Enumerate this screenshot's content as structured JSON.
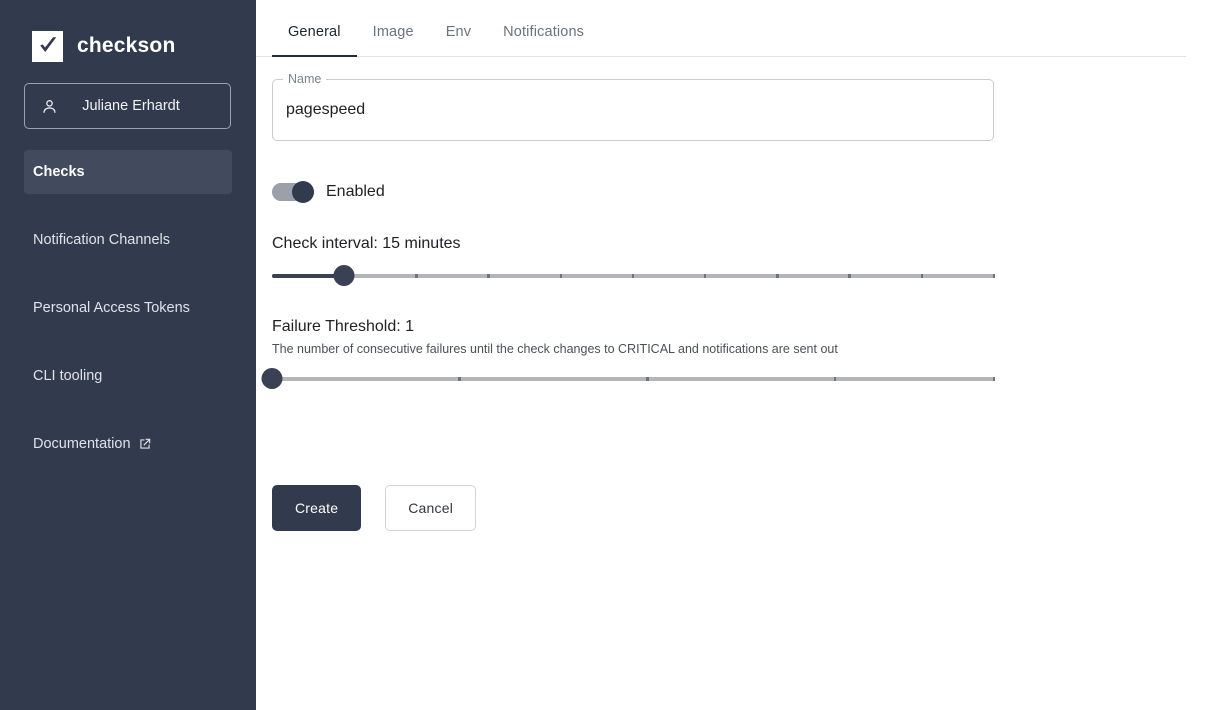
{
  "sidebar": {
    "brand": {
      "name": "checkson",
      "logo_icon": "checkmark-square-icon"
    },
    "user": {
      "name": "Juliane Erhardt",
      "icon": "account-person-icon"
    },
    "items": [
      {
        "label": "Checks",
        "active": true,
        "external": false
      },
      {
        "label": "Notification Channels",
        "active": false,
        "external": false
      },
      {
        "label": "Personal Access Tokens",
        "active": false,
        "external": false
      },
      {
        "label": "CLI tooling",
        "active": false,
        "external": false
      },
      {
        "label": "Documentation",
        "active": false,
        "external": true,
        "external_icon": "external-link-icon"
      }
    ]
  },
  "main": {
    "tabs": [
      {
        "label": "General",
        "active": true
      },
      {
        "label": "Image",
        "active": false
      },
      {
        "label": "Env",
        "active": false
      },
      {
        "label": "Notifications",
        "active": false
      }
    ],
    "name_field": {
      "label": "Name",
      "value": "pagespeed",
      "placeholder": ""
    },
    "enabled_toggle": {
      "label": "Enabled",
      "state": "on"
    },
    "check_interval": {
      "title": "Check interval: 15 minutes",
      "value_label": "15 minutes",
      "percent": 10,
      "marks_percent": [
        10,
        20,
        30,
        40,
        50,
        60,
        70,
        80,
        90,
        100
      ]
    },
    "failure_threshold": {
      "title": "Failure Threshold: 1",
      "value_label": "1",
      "help": "The number of consecutive failures until the check changes to CRITICAL and notifications are sent out",
      "percent": 0,
      "marks_percent": [
        26,
        52,
        78,
        100
      ]
    },
    "actions": {
      "create_label": "Create",
      "cancel_label": "Cancel"
    }
  },
  "colors": {
    "sidebar_bg": "#323b4d",
    "sidebar_active": "#424b5e",
    "accent_dark": "#3a4154",
    "text_muted": "#6b7280",
    "page_bg": "#ffffff"
  }
}
